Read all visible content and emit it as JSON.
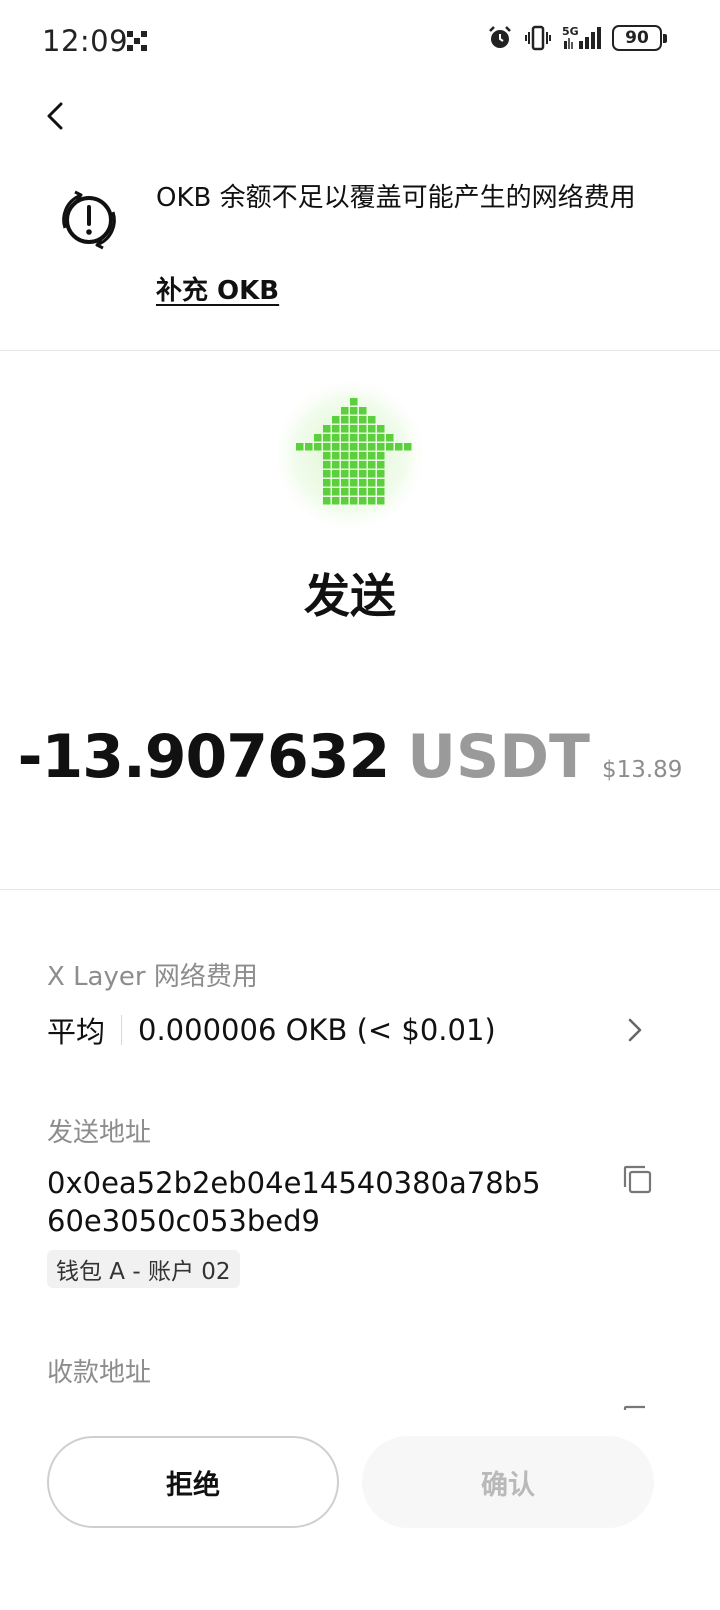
{
  "status_bar": {
    "time": "12:09",
    "battery": "90",
    "network": "5G",
    "icons": [
      "app-grid-icon",
      "alarm-icon",
      "vibrate-icon",
      "signal-icon",
      "battery-icon"
    ]
  },
  "warning": {
    "text": "OKB 余额不足以覆盖可能产生的网络费用",
    "link": "补充 OKB",
    "icon": "alert-icon"
  },
  "transaction": {
    "title": "发送",
    "amount": "-13.907632",
    "unit": "USDT",
    "usd_value": "$13.89",
    "icon": "send-arrow-icon",
    "accent_color": "#5ccf3d"
  },
  "fee": {
    "label": "X Layer 网络费用",
    "speed": "平均",
    "value": "0.000006 OKB (< $0.01)"
  },
  "sender": {
    "label": "发送地址",
    "address": "0x0ea52b2eb04e14540380a78b560e3050c053bed9",
    "account": "钱包 A - 账户 02"
  },
  "receiver": {
    "label": "收款地址"
  },
  "actions": {
    "reject": "拒绝",
    "confirm": "确认"
  }
}
